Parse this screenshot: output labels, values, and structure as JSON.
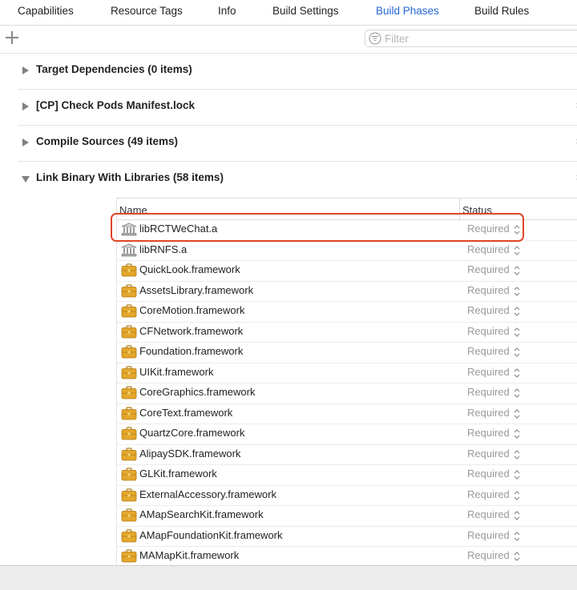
{
  "tabs": [
    {
      "label": "Capabilities",
      "active": false
    },
    {
      "label": "Resource Tags",
      "active": false
    },
    {
      "label": "Info",
      "active": false
    },
    {
      "label": "Build Settings",
      "active": false
    },
    {
      "label": "Build Phases",
      "active": true
    },
    {
      "label": "Build Rules",
      "active": false
    }
  ],
  "toolbar": {
    "add_icon": "plus-icon",
    "filter_placeholder": "Filter"
  },
  "phases": [
    {
      "title": "Target Dependencies (0 items)",
      "expanded": false,
      "closable": false
    },
    {
      "title": "[CP] Check Pods Manifest.lock",
      "expanded": false,
      "closable": true
    },
    {
      "title": "Compile Sources (49 items)",
      "expanded": false,
      "closable": true
    },
    {
      "title": "Link Binary With Libraries (58 items)",
      "expanded": true,
      "closable": true
    }
  ],
  "phase_close_glyph": "×",
  "libraries": {
    "columns": {
      "name": "Name",
      "status": "Status"
    },
    "rows": [
      {
        "name": "libRCTWeChat.a",
        "status": "Required",
        "icon": "library-icon",
        "highlighted": true
      },
      {
        "name": "libRNFS.a",
        "status": "Required",
        "icon": "library-icon"
      },
      {
        "name": "QuickLook.framework",
        "status": "Required",
        "icon": "framework-icon"
      },
      {
        "name": "AssetsLibrary.framework",
        "status": "Required",
        "icon": "framework-icon"
      },
      {
        "name": "CoreMotion.framework",
        "status": "Required",
        "icon": "framework-icon"
      },
      {
        "name": "CFNetwork.framework",
        "status": "Required",
        "icon": "framework-icon"
      },
      {
        "name": "Foundation.framework",
        "status": "Required",
        "icon": "framework-icon"
      },
      {
        "name": "UIKit.framework",
        "status": "Required",
        "icon": "framework-icon"
      },
      {
        "name": "CoreGraphics.framework",
        "status": "Required",
        "icon": "framework-icon"
      },
      {
        "name": "CoreText.framework",
        "status": "Required",
        "icon": "framework-icon"
      },
      {
        "name": "QuartzCore.framework",
        "status": "Required",
        "icon": "framework-icon"
      },
      {
        "name": "AlipaySDK.framework",
        "status": "Required",
        "icon": "framework-icon"
      },
      {
        "name": "GLKit.framework",
        "status": "Required",
        "icon": "framework-icon"
      },
      {
        "name": "ExternalAccessory.framework",
        "status": "Required",
        "icon": "framework-icon"
      },
      {
        "name": "AMapSearchKit.framework",
        "status": "Required",
        "icon": "framework-icon"
      },
      {
        "name": "AMapFoundationKit.framework",
        "status": "Required",
        "icon": "framework-icon"
      },
      {
        "name": "MAMapKit.framework",
        "status": "Required",
        "icon": "framework-icon"
      }
    ]
  },
  "colors": {
    "accent": "#2566d8",
    "highlight": "#e0452a",
    "framework": "#e3a72b",
    "muted": "#9a9a9a"
  }
}
